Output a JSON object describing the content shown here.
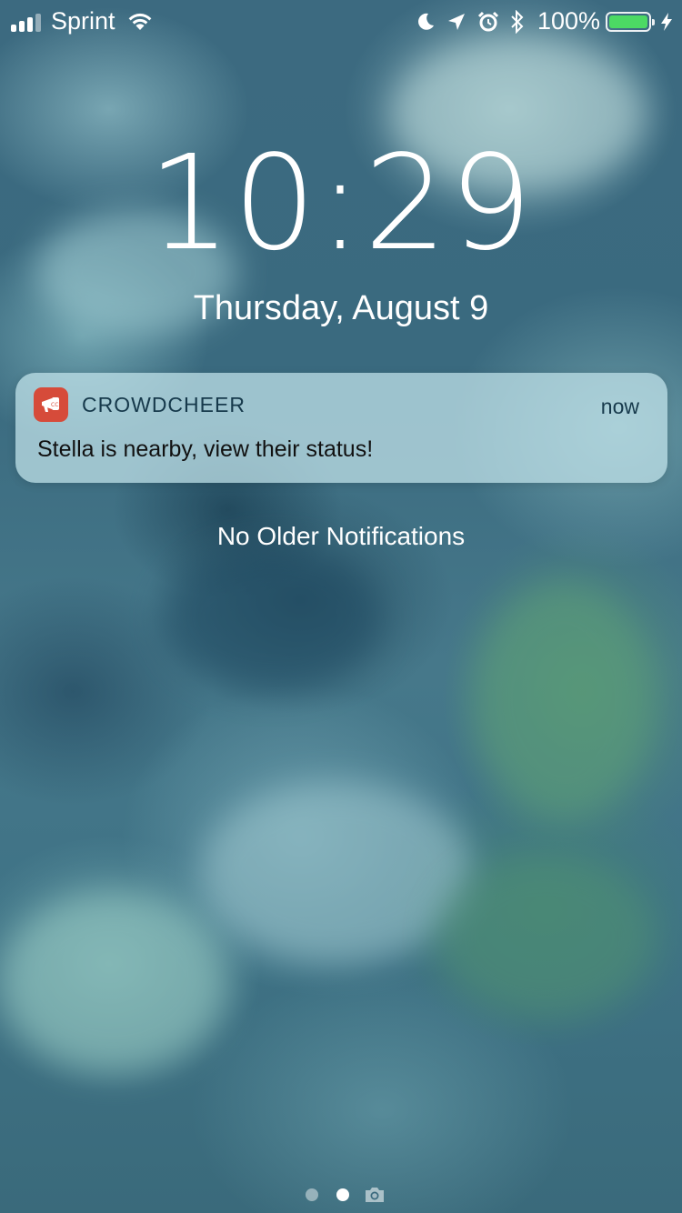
{
  "status_bar": {
    "carrier": "Sprint",
    "battery_percent": "100%",
    "battery_level": 1.0,
    "signal_bars_filled": 3,
    "signal_bars_total": 4,
    "icons": [
      "signal-icon",
      "wifi-icon",
      "moon-icon",
      "location-arrow-icon",
      "alarm-icon",
      "bluetooth-icon",
      "battery-icon",
      "charging-bolt-icon"
    ]
  },
  "lock_screen": {
    "time": "10:29",
    "date": "Thursday, August 9"
  },
  "notification": {
    "app_name": "CROWDCHEER",
    "time": "now",
    "body": "Stella is nearby, view their status!",
    "app_icon": "megaphone-icon",
    "app_icon_color": "#d64b3a"
  },
  "notification_center": {
    "empty_label": "No Older Notifications"
  },
  "page_indicator": {
    "pages": 2,
    "active_page": 2,
    "trailing_icon": "camera-icon"
  },
  "colors": {
    "battery_fill": "#4cd964",
    "notification_background": "#c4e4ec",
    "text_primary": "#ffffff"
  }
}
